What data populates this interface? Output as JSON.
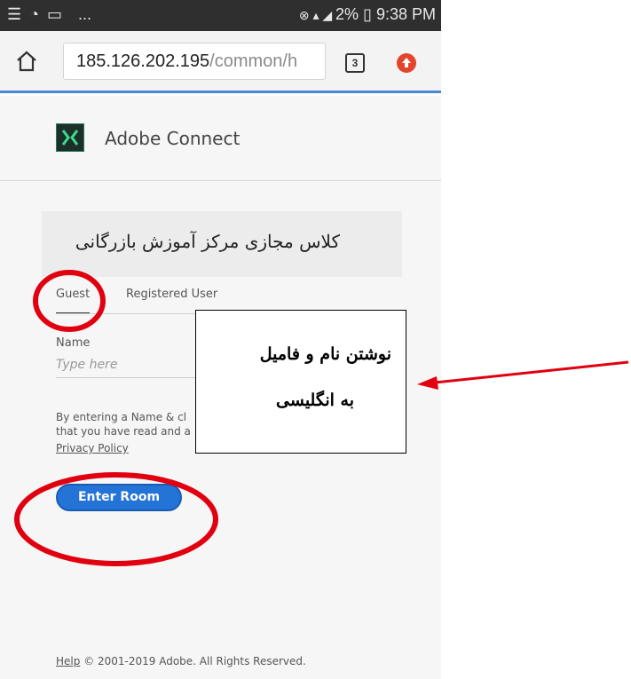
{
  "status_bar": {
    "left_icons": "☰ ◔ ▭",
    "left_more": "...",
    "right_text": "2% ▯ 9:38 PM"
  },
  "browser": {
    "url_host": "185.126.202.195",
    "url_path": "/common/h",
    "tab_count": "3"
  },
  "header": {
    "title": "Adobe Connect"
  },
  "room": {
    "title": "کلاس مجازی مرکز آموزش بازرگانی"
  },
  "tabs": {
    "guest": "Guest",
    "registered": "Registered User"
  },
  "form": {
    "name_label": "Name",
    "name_placeholder": "Type here",
    "disclaimer_line1": "By entering a Name & cl",
    "disclaimer_line2": "that you have read and a",
    "privacy_link": "Privacy Policy",
    "enter_button": "Enter Room"
  },
  "footer": {
    "help": "Help",
    "copyright": "© 2001-2019 Adobe. All Rights Reserved."
  },
  "annotation": {
    "line1": "نوشتن نام و فامیل",
    "line2": "به انگلیسی"
  },
  "colors": {
    "accent": "#2473d6",
    "annotation_red": "#e1000f"
  }
}
